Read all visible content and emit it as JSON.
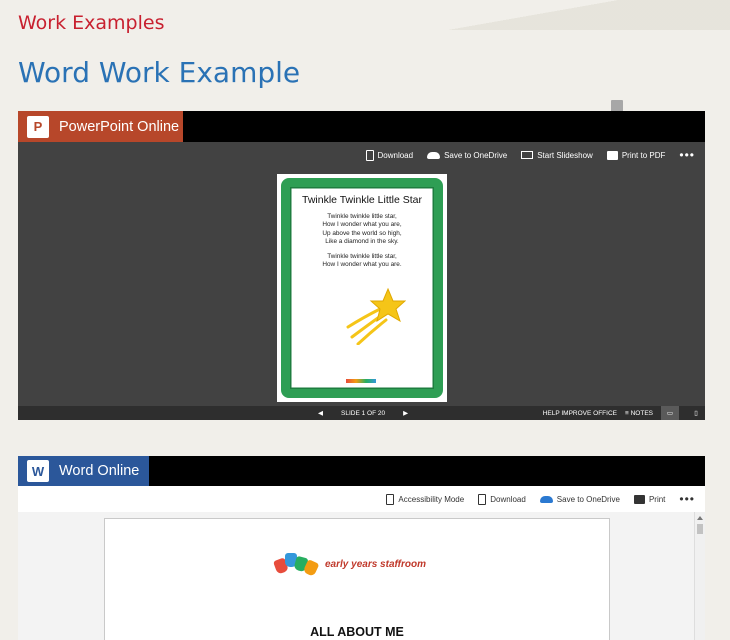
{
  "section_title": "Work Examples",
  "page_heading": "Word Work Example",
  "ppt_viewer": {
    "app_name": "PowerPoint Online",
    "logo_letter": "P",
    "toolbar": {
      "download": "Download",
      "save_onedrive": "Save to OneDrive",
      "start_slideshow": "Start Slideshow",
      "print_pdf": "Print to PDF",
      "more": "•••"
    },
    "slide": {
      "title": "Twinkle Twinkle Little Star",
      "verse1": [
        "Twinkle twinkle little star,",
        "How I wonder what you are,",
        "Up above the world so high,",
        "Like a diamond in the sky."
      ],
      "verse2": [
        "Twinkle twinkle little star,",
        "How I wonder what you are."
      ]
    },
    "status": {
      "slide_counter": "SLIDE 1 OF 20",
      "help": "HELP IMPROVE OFFICE",
      "notes": "NOTES"
    }
  },
  "word_viewer": {
    "app_name": "Word Online",
    "logo_letter": "W",
    "toolbar": {
      "accessibility": "Accessibility Mode",
      "download": "Download",
      "save_onedrive": "Save to OneDrive",
      "print": "Print",
      "more": "•••"
    },
    "document": {
      "logo_text": "early years staffroom",
      "heading": "ALL ABOUT ME"
    }
  },
  "colors": {
    "title_red": "#c8202f",
    "heading_blue": "#2a72b5",
    "ppt_orange": "#b7472a",
    "word_blue": "#2b579a",
    "frame_green": "#2e9e54",
    "star_yellow": "#f5c518"
  }
}
